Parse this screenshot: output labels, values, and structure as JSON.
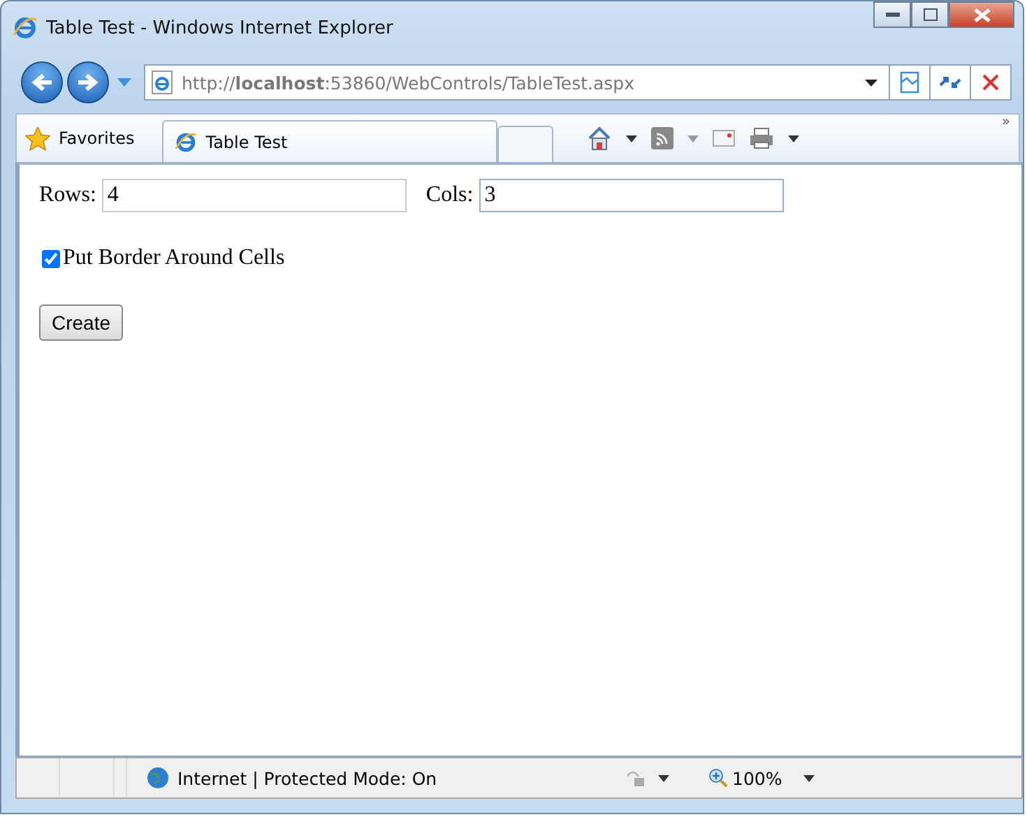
{
  "window": {
    "title": "Table Test - Windows Internet Explorer"
  },
  "address_bar": {
    "url": "http://**localhost**:53860/WebControls/TableTest.aspx"
  },
  "favorites_bar": {
    "favorites": "Favorites",
    "tabs": [
      {
        "label": "Table Test",
        "selected": true
      }
    ],
    "chevron": "»"
  },
  "form": {
    "rows_label": "Rows:",
    "rows_value": "4",
    "cols_label": "Cols:",
    "cols_value": "3",
    "border_checkbox": {
      "label": "Put Border Around Cells",
      "checked": true
    },
    "create_button": "Create"
  },
  "status_bar": {
    "zone": "Internet | Protected Mode: On",
    "zoom": "100%"
  }
}
